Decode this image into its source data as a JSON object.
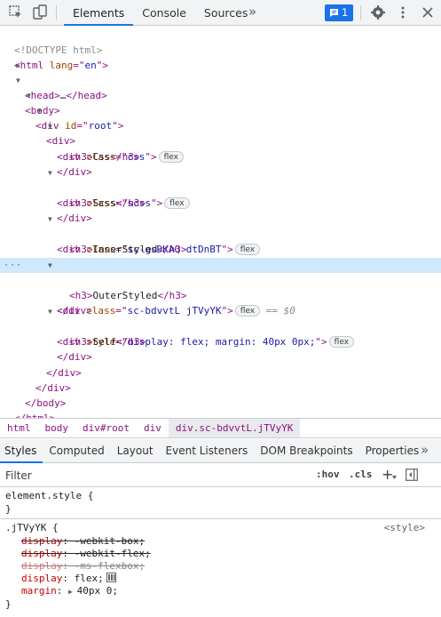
{
  "toolbar": {
    "tabs": [
      "Elements",
      "Console",
      "Sources"
    ],
    "more": "»",
    "issues_count": "1"
  },
  "dom_lines": [
    {
      "t": "<!DOCTYPE html>"
    },
    {
      "t": "<html lang=\"en\">"
    },
    {
      "t": "<head>…</head>"
    },
    {
      "t": "<body>"
    },
    {
      "t": "<div id=\"root\">"
    },
    {
      "t": "<div>"
    },
    {
      "t": "<div class=\"css\">",
      "badge": "flex"
    },
    {
      "t": "<h3>Css</h3>"
    },
    {
      "t": "</div>"
    },
    {
      "t": "<div class=\"scss\">",
      "badge": "flex"
    },
    {
      "t": "<h3>Scss</h3>"
    },
    {
      "t": "</div>"
    },
    {
      "t": "<div class=\"sc-gsDKAQ dtDnBT\">",
      "badge": "flex"
    },
    {
      "t": "<h3>InnerStyled</h3>"
    },
    {
      "t": "</div>"
    },
    {
      "t": "<div class=\"sc-bdvvtL jTVyYK\">",
      "badge": "flex",
      "note": "== $0",
      "selected": true
    },
    {
      "t": "<h3>OuterStyled</h3>"
    },
    {
      "t": "</div>"
    },
    {
      "t": "<div style=\"display: flex; margin: 40px 0px;\">",
      "badge": "flex"
    },
    {
      "t": "<h3>Self</h3>"
    },
    {
      "t": "</div>"
    },
    {
      "t": "</div>"
    },
    {
      "t": "</div>"
    },
    {
      "t": "</body>"
    },
    {
      "t": "</html>"
    }
  ],
  "breadcrumbs": [
    "html",
    "body",
    "div#root",
    "div",
    "div.sc-bdvvtL.jTVyYK"
  ],
  "lower_tabs": [
    "Styles",
    "Computed",
    "Layout",
    "Event Listeners",
    "DOM Breakpoints",
    "Properties"
  ],
  "lower_more": "»",
  "filter": {
    "placeholder": "Filter",
    "hov": ":hov",
    "cls": ".cls"
  },
  "styles": {
    "element_style": {
      "selector": "element.style {",
      "close": "}"
    },
    "rule": {
      "selector": ".jTVyYK {",
      "source": "<style>",
      "declarations": [
        {
          "prop": "display",
          "value": "-webkit-box;",
          "struck": true
        },
        {
          "prop": "display",
          "value": "-webkit-flex;",
          "struck": true
        },
        {
          "prop": "display",
          "value": "-ms-flexbox;",
          "struck": true
        },
        {
          "prop": "display",
          "value": "flex;",
          "struck": false
        },
        {
          "prop": "margin",
          "value": "40px 0;",
          "struck": false
        }
      ],
      "close": "}"
    }
  },
  "colors": {
    "accent": "#1a73e8",
    "tag": "#881280",
    "attr": "#994500",
    "value": "#1a1aa6",
    "selection": "#cfe8fc"
  }
}
